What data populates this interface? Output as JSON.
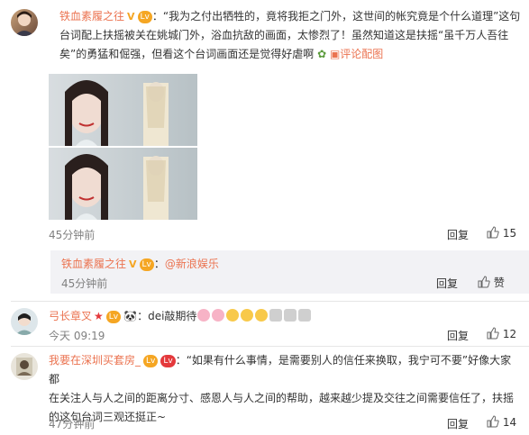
{
  "comments": [
    {
      "username": "铁血素履之往",
      "text_lines": [
        "：“我为之付出牺牲的，竟将我拒之门外，这世间的帐究竟是个什么道理”这句",
        "台词配上扶摇被关在姚城门外，浴血抗敌的画面，太惨烈了！虽然知道这是扶摇“虽千万人吾往",
        "矣”的勇猛和倔强，但看这个台词画面还是觉得好虐啊"
      ],
      "view_image_label": "评论配图",
      "time": "45分钟前",
      "reply_label": "回复",
      "like_count": "15"
    },
    {
      "username": "铁血素履之往",
      "text_prefix": "：",
      "mention": "@新浪娱乐",
      "time": "45分钟前",
      "reply_label": "回复",
      "like_label": "赞"
    },
    {
      "username": "弓长章叉",
      "text": "dei敲期待",
      "time": "今天 09:19",
      "reply_label": "回复",
      "like_count": "12"
    },
    {
      "username": "我要在深圳买套房_",
      "text_lines": [
        "：“如果有什么事情，是需要别人的信任来换取，我宁可不要”好像大家都",
        "在关注人与人之间的距离分寸、感恩人与人之间的帮助，越来越少提及交往之间需要信任了，扶摇",
        "的这句台词三观还挺正~"
      ],
      "time": "47分钟前",
      "reply_label": "回复",
      "like_count": "14"
    }
  ],
  "badges": {
    "vip": "V",
    "level_1": "Lv",
    "level_red": "Lv"
  },
  "colors": {
    "username": "#eb7350",
    "time": "#808080",
    "reply_bg": "#f2f2f5"
  }
}
